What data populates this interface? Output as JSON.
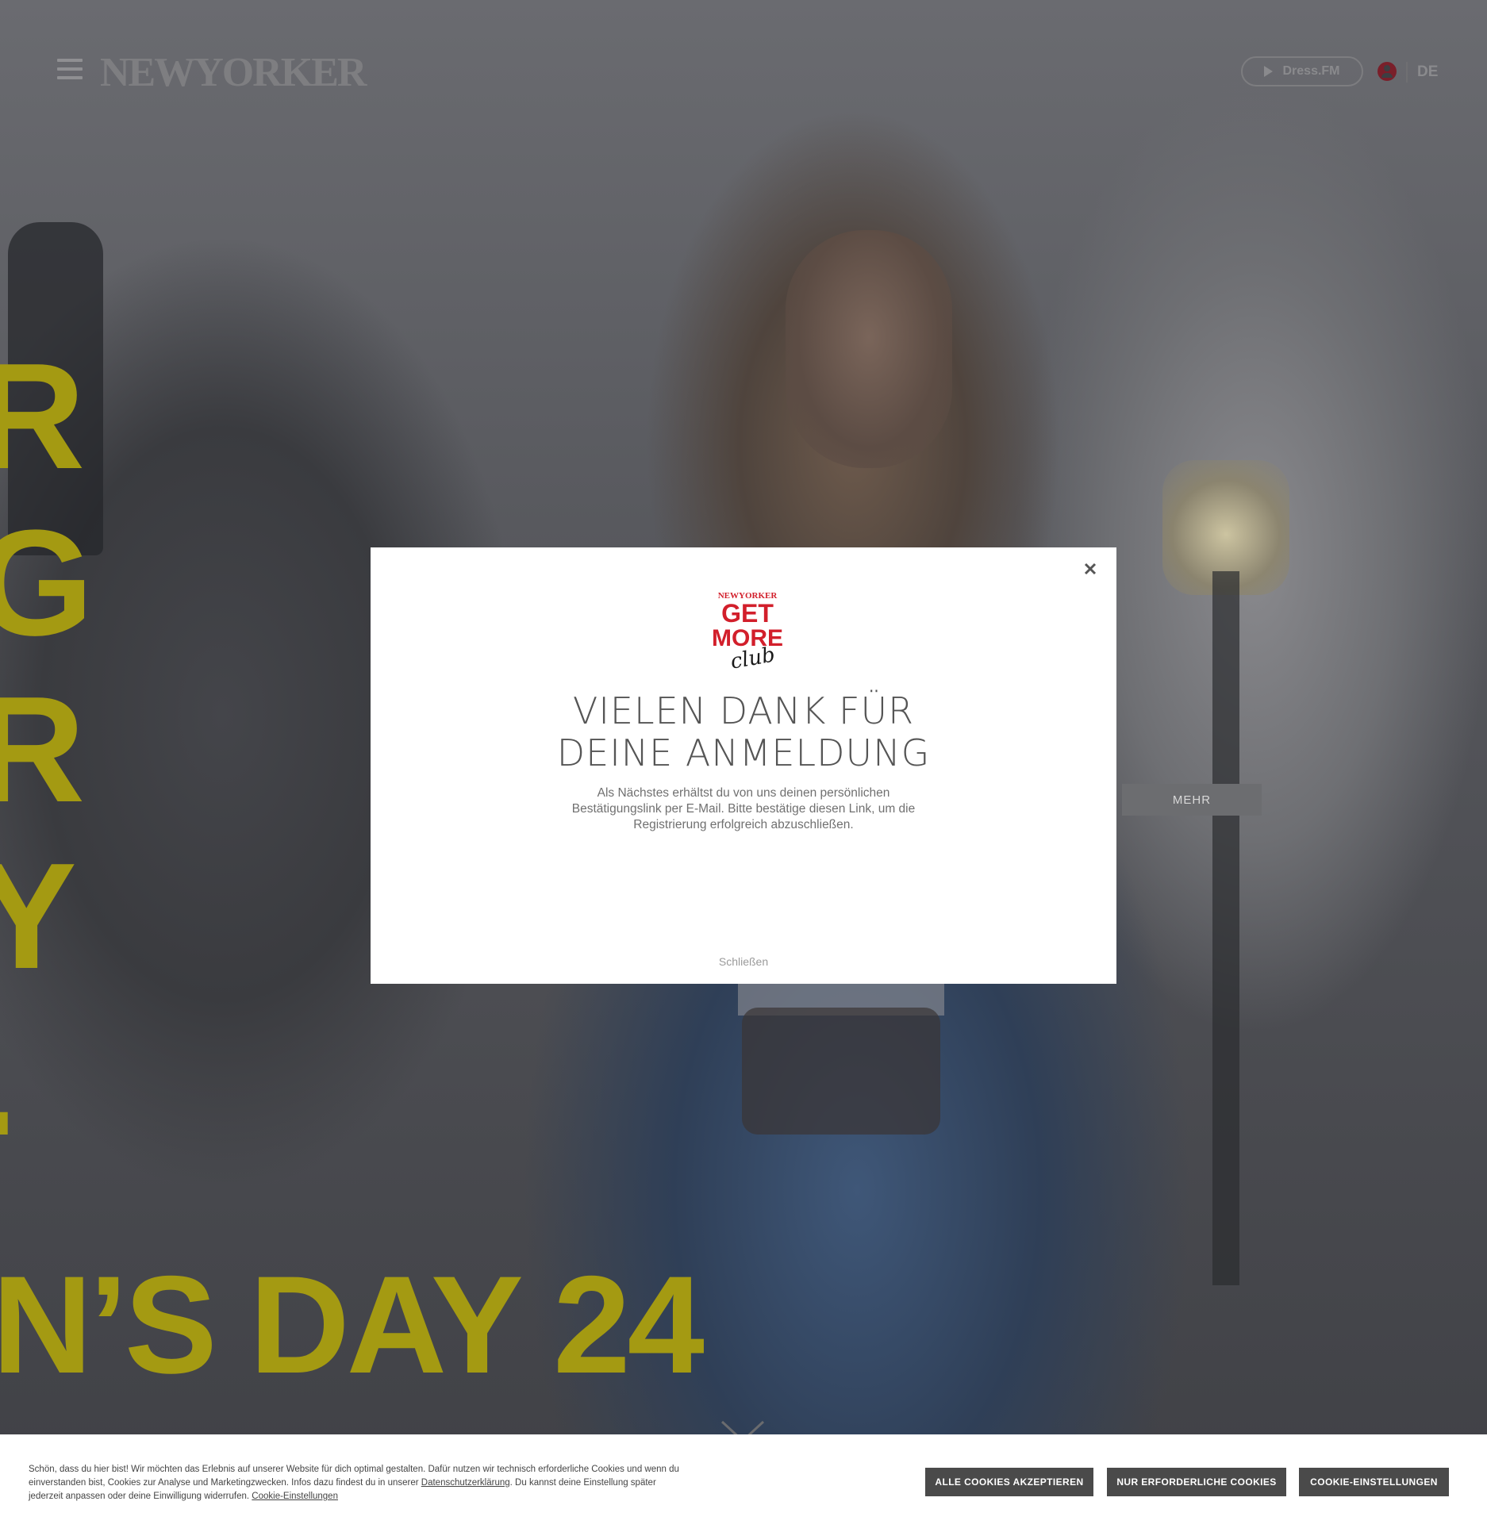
{
  "header": {
    "logo": "NEWYORKER",
    "dressfm_label": "Dress.FM",
    "language": "DE"
  },
  "hero": {
    "vertical_letters": [
      "R",
      "G",
      "R",
      "Y",
      "."
    ],
    "tagline": "N’S DAY 24",
    "more_button": "MEHR"
  },
  "modal": {
    "logo_brand": "NEWYORKER",
    "logo_get": "GET",
    "logo_more": "MORE",
    "logo_club": "club",
    "title_line1": "VIELEN DANK FÜR",
    "title_line2": "DEINE ANMELDUNG",
    "text": "Als Nächstes erhältst du von uns deinen persönlichen Bestätigungslink per E-Mail. Bitte bestätige diesen Link, um die Registrierung erfolgreich abzuschließen.",
    "close_link": "Schließen"
  },
  "cookie": {
    "text_before": "Schön, dass du hier bist! Wir möchten das Erlebnis auf unserer Website für dich optimal gestalten. Dafür nutzen wir technisch erforderliche Cookies und wenn du einverstanden bist, Cookies zur Analyse und Marketingzwecken. Infos dazu findest du in unserer ",
    "privacy_link": "Datenschutzerklärung",
    "text_middle": ". Du kannst deine Einstellung später jederzeit anpassen oder deine Einwilligung widerrufen. ",
    "settings_link": "Cookie-Einstellungen",
    "accept_all": "ALLE COOKIES AKZEPTIEREN",
    "necessary_only": "NUR ERFORDERLICHE COOKIES",
    "settings_button": "COOKIE-EINSTELLUNGEN"
  },
  "colors": {
    "accent_red": "#d21f2b",
    "hero_yellow": "#a49a12",
    "button_dark": "#4a4a4a"
  },
  "icons": [
    "hamburger-menu-icon",
    "play-icon",
    "account-icon",
    "close-icon",
    "chevron-down-icon"
  ]
}
